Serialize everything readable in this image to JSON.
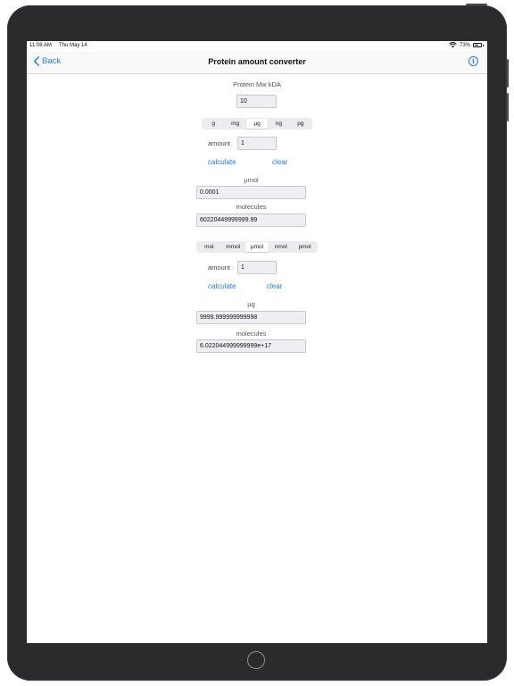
{
  "status_bar": {
    "time": "11:08 AM",
    "date": "Thu May 14",
    "battery_text": "73%",
    "battery_level": 0.73
  },
  "nav": {
    "back_label": "Back",
    "title": "Protein amount converter",
    "info_glyph": "i"
  },
  "mw": {
    "label": "Protein Mw kDA",
    "value": "10"
  },
  "mass_section": {
    "units": [
      "g",
      "mg",
      "µg",
      "ng",
      "pg"
    ],
    "selected_unit": "µg",
    "amount_label": "amount",
    "amount_value": "1",
    "calculate_label": "calculate",
    "clear_label": "clear",
    "result_unit_label": "µmol",
    "result_value": "0.0001",
    "molecules_label": "molecules",
    "molecules_value": "60220449999999.99"
  },
  "molar_section": {
    "units": [
      "mol",
      "mmol",
      "µmol",
      "nmol",
      "pmol"
    ],
    "selected_unit": "µmol",
    "amount_label": "amount",
    "amount_value": "1",
    "calculate_label": "calculate",
    "clear_label": "clear",
    "result_unit_label": "µg",
    "result_value": "9999.999999999998",
    "molecules_label": "molecules",
    "molecules_value": "6.022044999999999e+17"
  },
  "colors": {
    "accent": "#1a7cf5",
    "device_frame": "#2b2b2d"
  }
}
